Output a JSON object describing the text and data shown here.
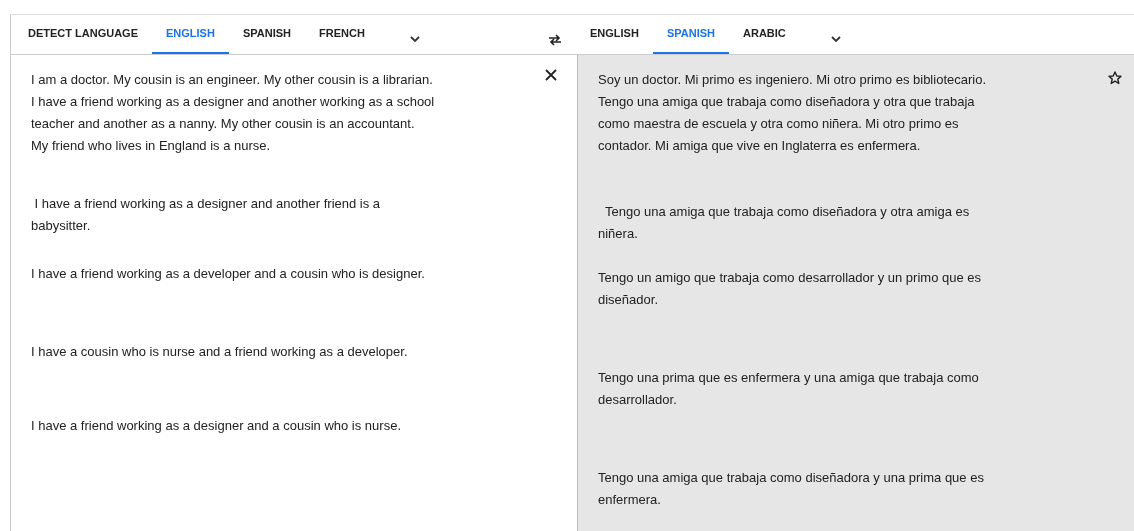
{
  "source_tabs": [
    {
      "label": "DETECT LANGUAGE",
      "selected": false
    },
    {
      "label": "ENGLISH",
      "selected": true
    },
    {
      "label": "SPANISH",
      "selected": false
    },
    {
      "label": "FRENCH",
      "selected": false
    }
  ],
  "target_tabs": [
    {
      "label": "ENGLISH",
      "selected": false
    },
    {
      "label": "SPANISH",
      "selected": true
    },
    {
      "label": "ARABIC",
      "selected": false
    }
  ],
  "source_text": [
    {
      "lines": [
        "I am a doctor. My cousin is an engineer. My other cousin is a librarian.",
        "I have a friend working as a designer and another working as a school",
        "teacher and another as a nanny. My other cousin is an accountant.",
        "My friend who lives in England is a nurse."
      ]
    },
    {
      "lines": [
        " I have a friend working as a designer and another friend is a",
        "babysitter."
      ]
    },
    {
      "lines": [
        "I have a friend working as a developer and a cousin who is designer."
      ]
    },
    {
      "lines": [
        "I have a cousin who is nurse and a friend working as a developer."
      ]
    },
    {
      "lines": [
        "I have a friend working as a designer and a cousin who is nurse."
      ]
    }
  ],
  "translation": [
    {
      "lines": [
        "Soy un doctor. Mi primo es ingeniero. Mi otro primo es bibliotecario.",
        "Tengo una amiga que trabaja como diseñadora y otra que trabaja",
        "como maestra de escuela y otra como niñera. Mi otro primo es",
        "contador. Mi amiga que vive en Inglaterra es enfermera."
      ]
    },
    {
      "lines": [
        "  Tengo una amiga que trabaja como diseñadora y otra amiga es",
        "niñera."
      ]
    },
    {
      "lines": [
        "Tengo un amigo que trabaja como desarrollador y un primo que es",
        "diseñador."
      ]
    },
    {
      "lines": [
        "Tengo una prima que es enfermera y una amiga que trabaja como",
        "desarrollador."
      ]
    },
    {
      "lines": [
        "Tengo una amiga que trabaja como diseñadora y una prima que es",
        "enfermera."
      ]
    }
  ]
}
